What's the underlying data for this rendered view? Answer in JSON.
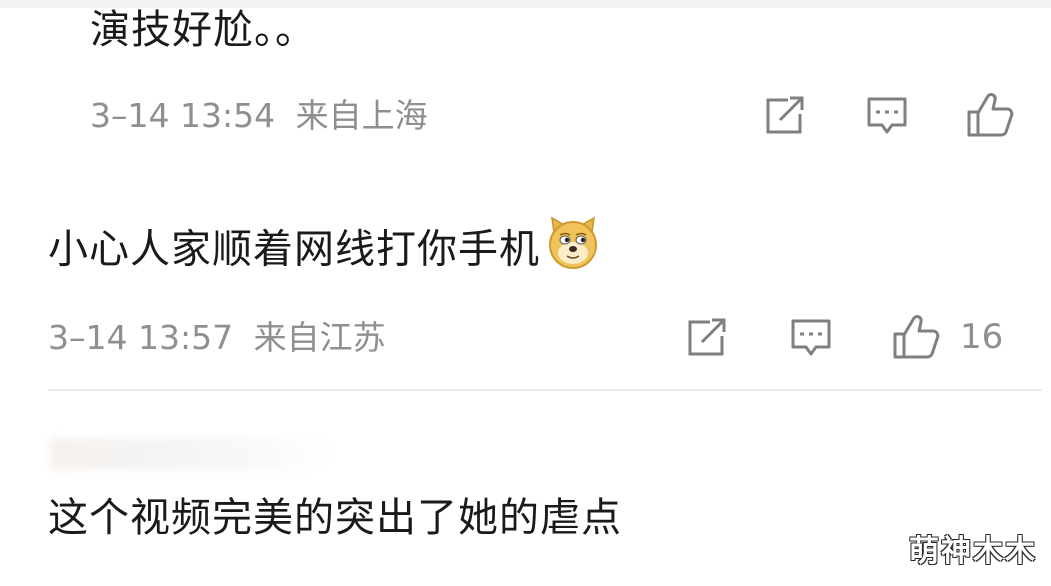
{
  "comments": [
    {
      "text": "演技好尬。。",
      "time": "3–14 13:54",
      "location": "来自上海",
      "like_count": ""
    },
    {
      "text": "小心人家顺着网线打你手机",
      "emoji": "doge-emoji",
      "time": "3–14 13:57",
      "location": "来自江苏",
      "like_count": "16"
    },
    {
      "text": "这个视频完美的突出了她的虐点"
    }
  ],
  "icons": {
    "share": "share-icon",
    "reply": "comment-icon",
    "like": "thumbs-up-icon"
  },
  "colors": {
    "text": "#1a1a1a",
    "meta": "#8f8f8f",
    "icon": "#7f7f7f",
    "divider": "#ececec"
  },
  "watermark": "萌神木木"
}
